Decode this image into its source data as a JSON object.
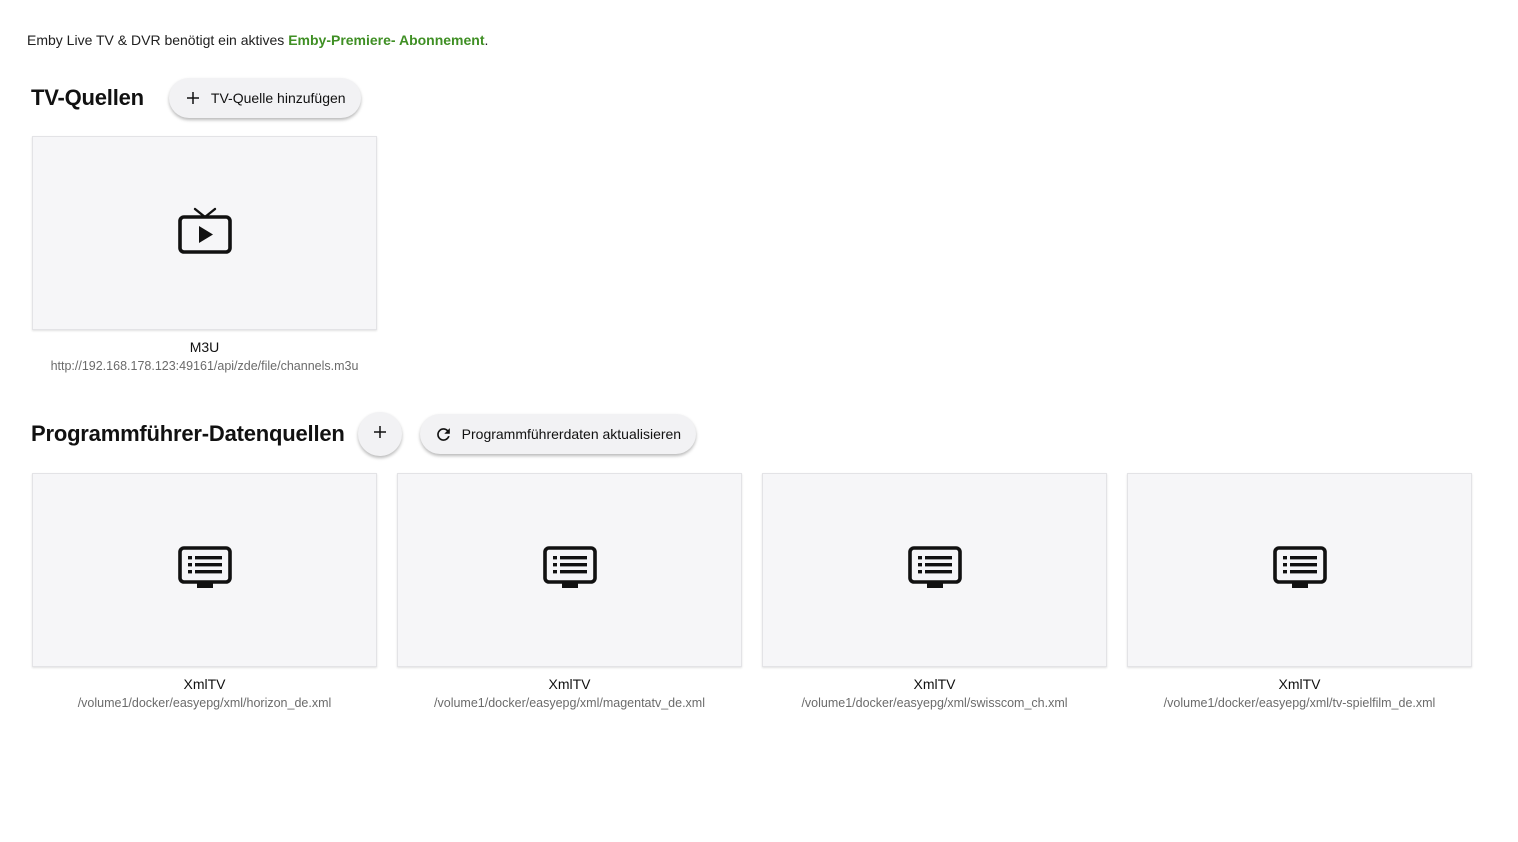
{
  "notice": {
    "prefix": "Emby Live TV & DVR benötigt ein aktives ",
    "link": "Emby-Premiere- Abonnement",
    "suffix": "."
  },
  "tv_sources": {
    "title": "TV-Quellen",
    "add_button_label": "TV-Quelle hinzufügen",
    "items": [
      {
        "title": "M3U",
        "subtitle": "http://192.168.178.123:49161/api/zde/file/channels.m3u",
        "icon": "live-tv-icon"
      }
    ]
  },
  "guide_sources": {
    "title": "Programmführer-Datenquellen",
    "refresh_button_label": "Programmführerdaten aktualisieren",
    "items": [
      {
        "title": "XmlTV",
        "subtitle": "/volume1/docker/easyepg/xml/horizon_de.xml",
        "icon": "guide-list-icon"
      },
      {
        "title": "XmlTV",
        "subtitle": "/volume1/docker/easyepg/xml/magentatv_de.xml",
        "icon": "guide-list-icon"
      },
      {
        "title": "XmlTV",
        "subtitle": "/volume1/docker/easyepg/xml/swisscom_ch.xml",
        "icon": "guide-list-icon"
      },
      {
        "title": "XmlTV",
        "subtitle": "/volume1/docker/easyepg/xml/tv-spielfilm_de.xml",
        "icon": "guide-list-icon"
      }
    ]
  },
  "colors": {
    "link": "#3f8f24",
    "card_background": "#f6f6f8",
    "button_background": "#f2f2f4"
  }
}
